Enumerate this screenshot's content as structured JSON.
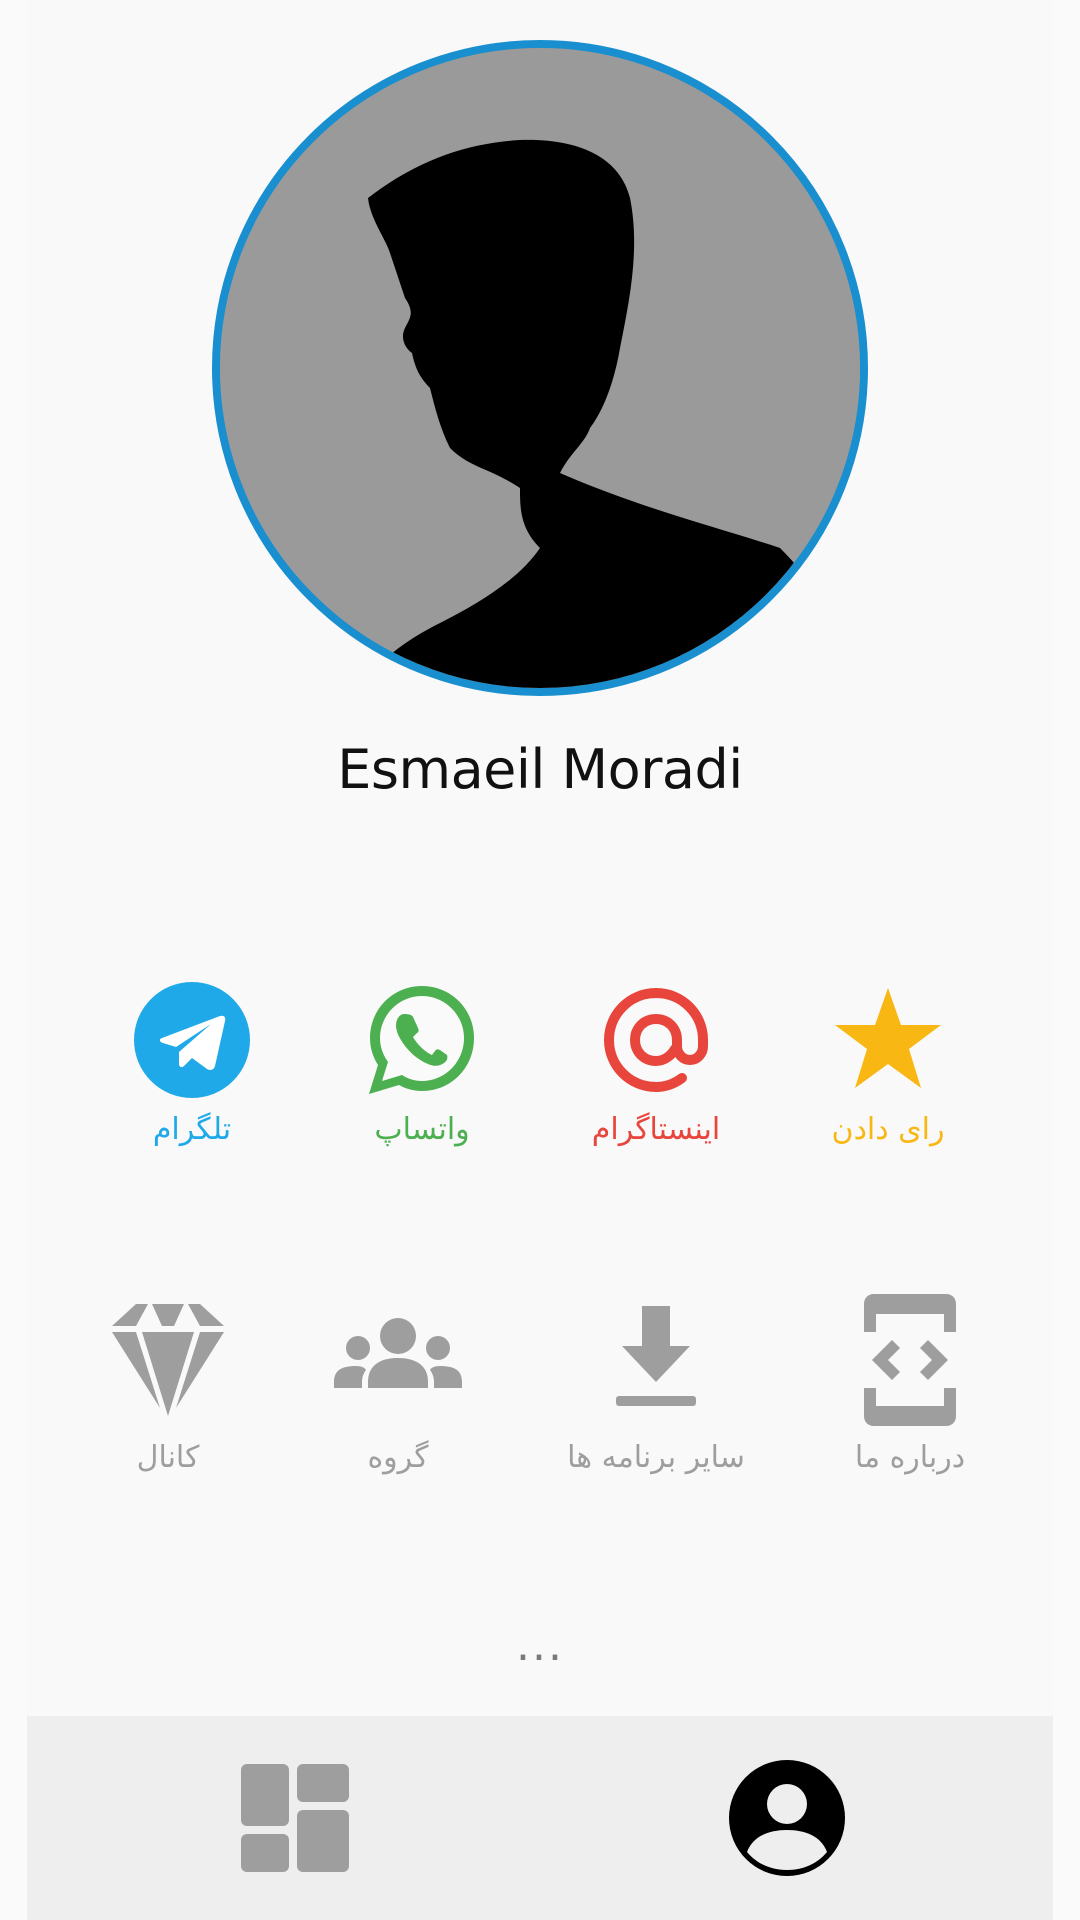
{
  "profile": {
    "name": "Esmaeil Moradi",
    "border_color": "#1a8fcf"
  },
  "social": [
    {
      "label": "تلگرام",
      "icon": "telegram-icon",
      "color": "#1fa9e9"
    },
    {
      "label": "واتساپ",
      "icon": "whatsapp-icon",
      "color": "#4caf50"
    },
    {
      "label": "اینستاگرام",
      "icon": "at-sign-icon",
      "color": "#e8453c"
    },
    {
      "label": "رای دادن",
      "icon": "star-icon",
      "color": "#f9b714"
    }
  ],
  "links": [
    {
      "label": "کانال",
      "icon": "diamond-icon"
    },
    {
      "label": "گروه",
      "icon": "group-icon"
    },
    {
      "label": "سایر برنامه ها",
      "icon": "download-icon"
    },
    {
      "label": "درباره ما",
      "icon": "developer-mode-icon"
    }
  ],
  "more_label": "...",
  "bottom_nav": [
    {
      "icon": "dashboard-icon",
      "active": false
    },
    {
      "icon": "account-icon",
      "active": true
    }
  ]
}
